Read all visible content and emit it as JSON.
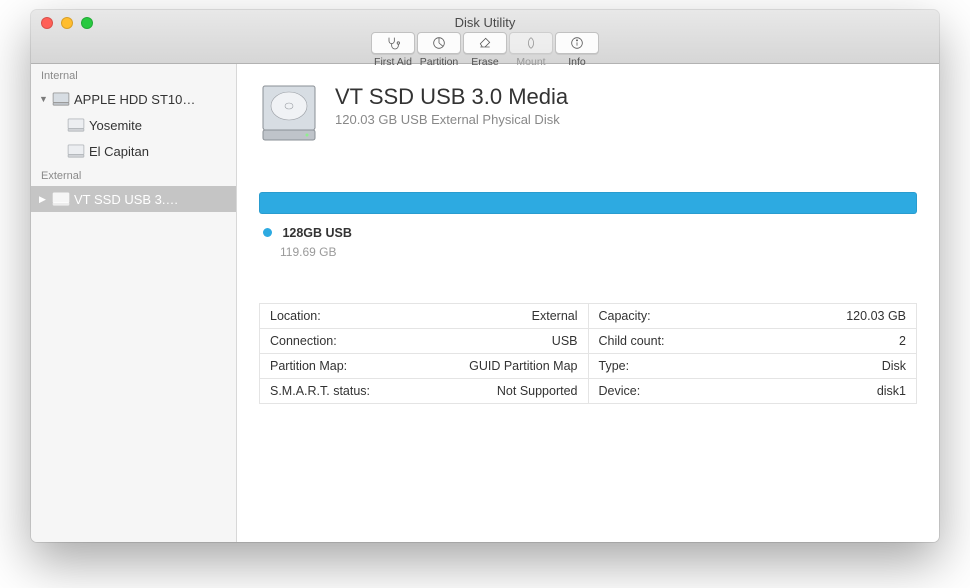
{
  "window": {
    "title": "Disk Utility"
  },
  "toolbar": {
    "items": [
      {
        "label": "First Aid",
        "icon": "firstaid",
        "enabled": true
      },
      {
        "label": "Partition",
        "icon": "partition",
        "enabled": true
      },
      {
        "label": "Erase",
        "icon": "erase",
        "enabled": true
      },
      {
        "label": "Mount",
        "icon": "mount",
        "enabled": false
      },
      {
        "label": "Info",
        "icon": "info",
        "enabled": true
      }
    ]
  },
  "sidebar": {
    "sections": [
      {
        "label": "Internal",
        "items": [
          {
            "name": "APPLE HDD ST10…",
            "expanded": true,
            "children": [
              {
                "name": "Yosemite"
              },
              {
                "name": "El Capitan"
              }
            ]
          }
        ]
      },
      {
        "label": "External",
        "items": [
          {
            "name": "VT SSD USB 3.…",
            "selected": true
          }
        ]
      }
    ]
  },
  "disk": {
    "title": "VT SSD USB 3.0 Media",
    "subtitle": "120.03 GB USB External Physical Disk",
    "partitions": [
      {
        "name": "128GB USB",
        "size": "119.69 GB",
        "color": "#2daae1"
      }
    ],
    "info_left": [
      {
        "k": "Location:",
        "v": "External"
      },
      {
        "k": "Connection:",
        "v": "USB"
      },
      {
        "k": "Partition Map:",
        "v": "GUID Partition Map"
      },
      {
        "k": "S.M.A.R.T. status:",
        "v": "Not Supported"
      }
    ],
    "info_right": [
      {
        "k": "Capacity:",
        "v": "120.03 GB"
      },
      {
        "k": "Child count:",
        "v": "2"
      },
      {
        "k": "Type:",
        "v": "Disk"
      },
      {
        "k": "Device:",
        "v": "disk1"
      }
    ]
  }
}
